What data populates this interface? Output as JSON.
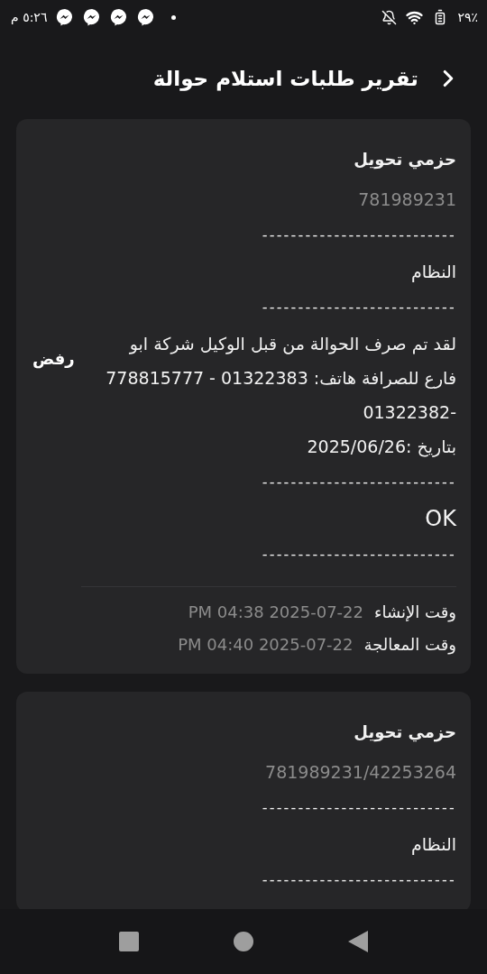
{
  "status_bar": {
    "time": "٥:٢٦ م",
    "battery": "٢٩٪"
  },
  "header": {
    "title": "تقرير طلبات استلام حوالة"
  },
  "cards": [
    {
      "status": "رفض",
      "lines": [
        {
          "kind": "name",
          "text": "حزمي تحويل"
        },
        {
          "kind": "account",
          "text": "781989231"
        },
        {
          "kind": "dashes",
          "text": "---------------------------"
        },
        {
          "kind": "text",
          "text": "النظام"
        },
        {
          "kind": "dashes",
          "text": "---------------------------"
        },
        {
          "kind": "text",
          "text": "لقد تم صرف الحوالة من قبل الوكيل شركة ابو فارع للصرافة هاتف: 01322383 - 778815777 -01322382"
        },
        {
          "kind": "text",
          "text": "بتاريخ :2025/06/26"
        },
        {
          "kind": "dashes",
          "text": "---------------------------"
        },
        {
          "kind": "result",
          "text": "OK"
        },
        {
          "kind": "dashes",
          "text": "---------------------------"
        }
      ],
      "times": [
        {
          "label": "وقت الإنشاء",
          "value": "2025-07-22 04:38 PM"
        },
        {
          "label": "وقت المعالجة",
          "value": "2025-07-22 04:40 PM"
        }
      ]
    },
    {
      "lines": [
        {
          "kind": "name",
          "text": "حزمي تحويل"
        },
        {
          "kind": "account",
          "text": "781989231/42253264"
        },
        {
          "kind": "dashes",
          "text": "---------------------------"
        },
        {
          "kind": "text",
          "text": "النظام"
        },
        {
          "kind": "dashes",
          "text": "---------------------------"
        }
      ]
    }
  ]
}
